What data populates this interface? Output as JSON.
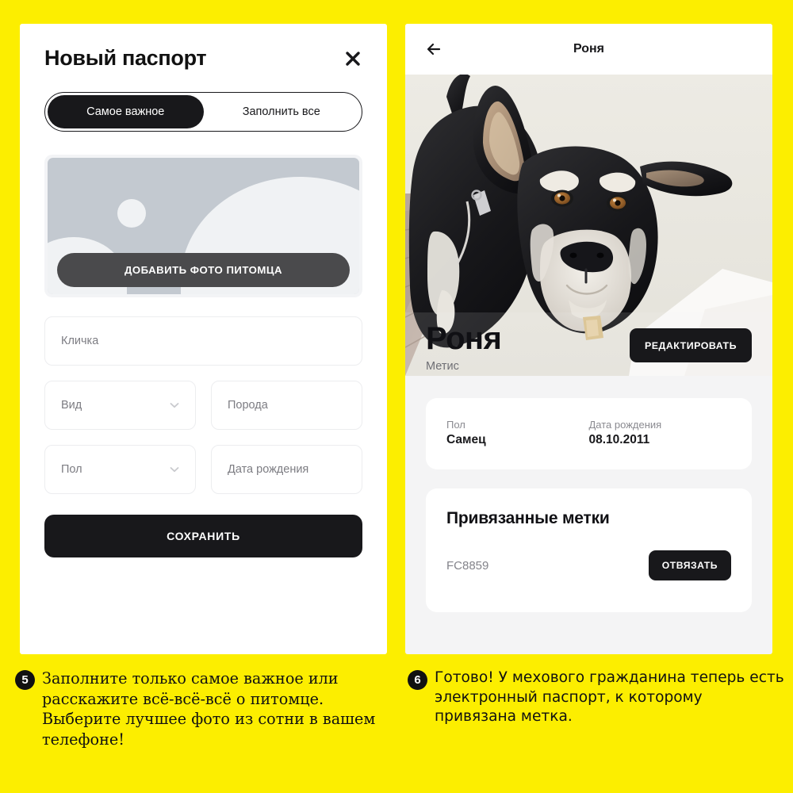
{
  "theme": {
    "background": "#FCEE00",
    "ink": "#18181B",
    "panel_right_bg": "#F4F4F5",
    "muted_text": "#7C7C82",
    "placeholder_bg": "#C3C9D0"
  },
  "form_panel": {
    "title": "Новый паспорт",
    "close_icon": "close-icon",
    "segmented": {
      "options": [
        {
          "label": "Самое важное",
          "active": true
        },
        {
          "label": "Заполнить все",
          "active": false
        }
      ]
    },
    "photo": {
      "icon": "image-placeholder-icon",
      "add_button_label": "ДОБАВИТЬ ФОТО ПИТОМЦА"
    },
    "fields": [
      {
        "name": "nickname",
        "placeholder": "Кличка",
        "value": "",
        "type": "text"
      },
      {
        "name": "species",
        "placeholder": "Вид",
        "value": "",
        "type": "select"
      },
      {
        "name": "breed",
        "placeholder": "Порода",
        "value": "",
        "type": "text"
      },
      {
        "name": "sex",
        "placeholder": "Пол",
        "value": "",
        "type": "select"
      },
      {
        "name": "birthdate",
        "placeholder": "Дата рождения",
        "value": "",
        "type": "text"
      }
    ],
    "save_label": "СОХРАНИТЬ"
  },
  "profile_panel": {
    "topbar": {
      "back_icon": "arrow-left-icon",
      "title": "Роня"
    },
    "hero": {
      "alt": "Чёрно-белая собака-метис смотрит в камеру",
      "icon": "dog-photo"
    },
    "pet": {
      "name": "Роня",
      "breed": "Метис",
      "edit_label": "РЕДАКТИРОВАТЬ"
    },
    "info": [
      {
        "label": "Пол",
        "value": "Самец"
      },
      {
        "label": "Дата рождения",
        "value": "08.10.2011"
      }
    ],
    "tags": {
      "title": "Привязанные метки",
      "items": [
        {
          "code": "FC8859",
          "action_label": "ОТВЯЗАТЬ"
        }
      ]
    }
  },
  "captions": [
    {
      "number": "5",
      "text": "Заполните только самое важное или расскажите всё-всё-всё о питомце. Выберите лучшее фото из сотни в вашем телефоне!"
    },
    {
      "number": "6",
      "text": "Готово! У мехового гражданина теперь есть электронный паспорт, к которому привязана метка."
    }
  ]
}
